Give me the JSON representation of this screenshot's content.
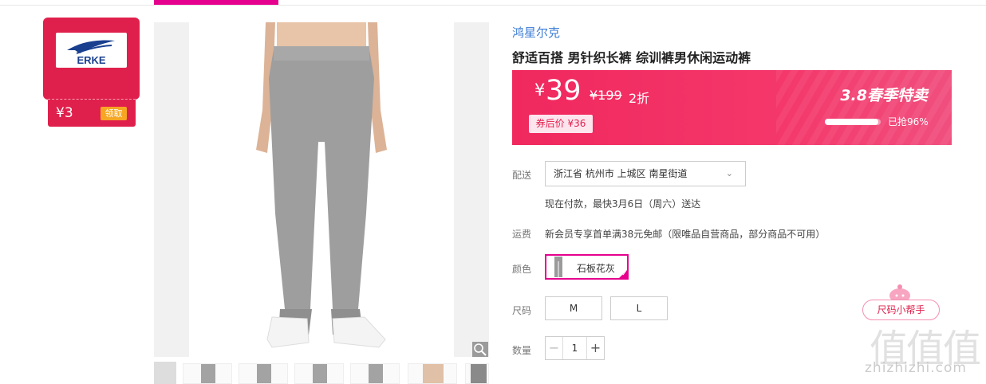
{
  "brand_coupon": {
    "logo_text": "ERKE",
    "amount": "¥3",
    "claim_label": "领取"
  },
  "product": {
    "brand": "鸿星尔克",
    "title": "舒适百搭 男针织长裤 综训裤男休闲运动裤"
  },
  "price_panel": {
    "currency": "¥",
    "price": "39",
    "original_price": "¥199",
    "discount": "2折",
    "coupon_price": "券后价 ¥36",
    "promo": "3.8春季特卖",
    "sold_progress": 0.96,
    "sold_text": "已抢96%"
  },
  "delivery": {
    "label": "配送",
    "address": "浙江省 杭州市 上城区 南星街道",
    "eta": "现在付款，最快3月6日（周六）送达"
  },
  "shipping": {
    "label": "运费",
    "text": "新会员专享首单满38元免邮（限唯品自营商品，部分商品不可用）"
  },
  "color": {
    "label": "颜色",
    "selected": "石板花灰"
  },
  "size": {
    "label": "尺码",
    "options": [
      "M",
      "L"
    ]
  },
  "quantity": {
    "label": "数量",
    "value": "1",
    "minus": "−",
    "plus": "+"
  },
  "size_helper": "尺码小帮手",
  "watermark": {
    "glyphs": "值值值",
    "url": "zhizhizhi.com"
  },
  "colors": {
    "accent": "#e6008e",
    "price_panel": "#f0285e",
    "brand_red": "#e0204c",
    "link_blue": "#3b7bd4"
  }
}
